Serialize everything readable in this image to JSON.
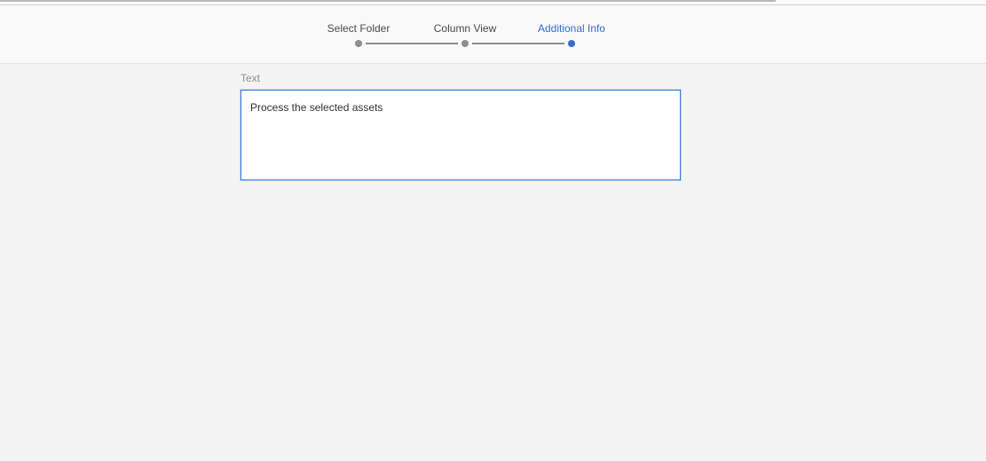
{
  "wizard": {
    "steps": [
      {
        "label": "Select Folder",
        "state": "completed"
      },
      {
        "label": "Column View",
        "state": "completed"
      },
      {
        "label": "Additional Info",
        "state": "active"
      }
    ],
    "colors": {
      "active": "#326ec8",
      "inactive": "#8e8e8e"
    }
  },
  "form": {
    "text_label": "Text",
    "text_value": "Process the selected assets"
  }
}
